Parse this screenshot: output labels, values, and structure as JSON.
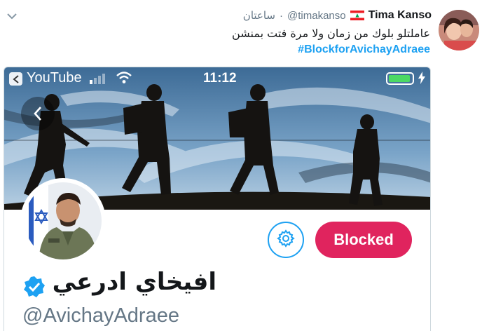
{
  "tweet": {
    "author_name": "Tima Kanso",
    "author_handle": "@timakanso",
    "separator": "·",
    "time": "ساعتان",
    "text": "عاملتلو بلوك من زمان ولا مرة فتت بمنشن",
    "hashtag": "#BlockforAvichayAdraee",
    "flag": "lebanon-flag-icon",
    "menu_icon": "chevron-down-icon"
  },
  "screenshot": {
    "status_bar": {
      "back_app_label": "YouTube",
      "time": "11:12",
      "battery_level": 0.95,
      "signal_bars": 4,
      "signal_active": 1
    },
    "profile": {
      "name": "افيخاي ادرعي",
      "handle": "@AvichayAdraee",
      "blocked_label": "Blocked",
      "verified": true
    }
  },
  "colors": {
    "accent": "#1da1f2",
    "blocked": "#e0245e",
    "secondary_text": "#657786",
    "battery": "#4cd964"
  }
}
